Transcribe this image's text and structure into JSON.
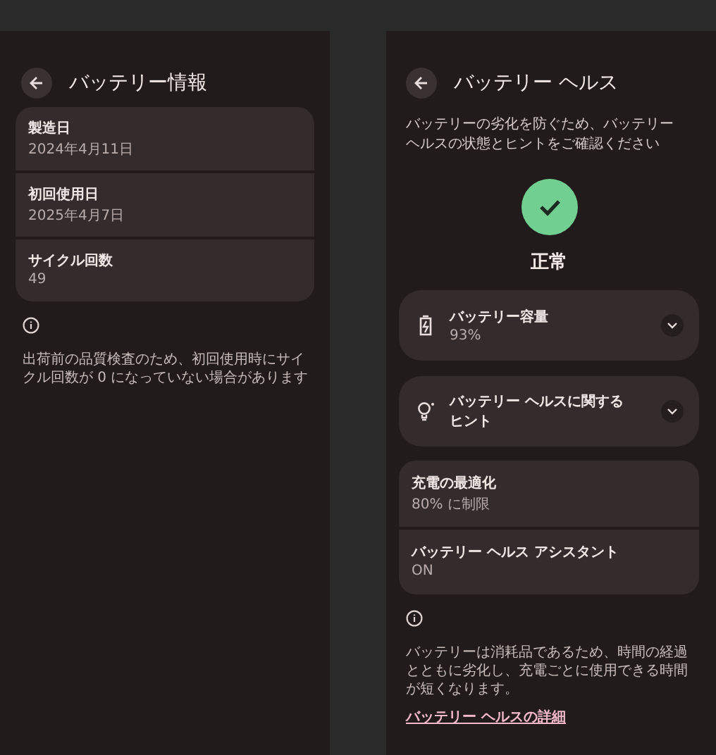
{
  "battery_info": {
    "title": "バッテリー情報",
    "items": [
      {
        "label": "製造日",
        "value": "2024年4月11日"
      },
      {
        "label": "初回使用日",
        "value": "2025年4月7日"
      },
      {
        "label": "サイクル回数",
        "value": "49"
      }
    ],
    "note": "出荷前の品質検査のため、初回使用時にサイクル回数が 0 になっていない場合があります"
  },
  "battery_health": {
    "title": "バッテリー ヘルス",
    "description": "バッテリーの劣化を防ぐため、バッテリーヘルスの状態とヒントをご確認ください",
    "status": "正常",
    "expandables": [
      {
        "kind": "capacity",
        "label": "バッテリー容量",
        "value": "93%",
        "expanded": false
      },
      {
        "kind": "tips",
        "label": "バッテリー ヘルスに関するヒント",
        "expanded": false
      }
    ],
    "settings": [
      {
        "label": "充電の最適化",
        "value": "80% に制限"
      },
      {
        "label": "バッテリー ヘルス アシスタント",
        "value": "ON"
      }
    ],
    "note": "バッテリーは消耗品であるため、時間の経過とともに劣化し、充電ごとに使用できる時間が短くなります。",
    "link": "バッテリー ヘルスの詳細"
  }
}
